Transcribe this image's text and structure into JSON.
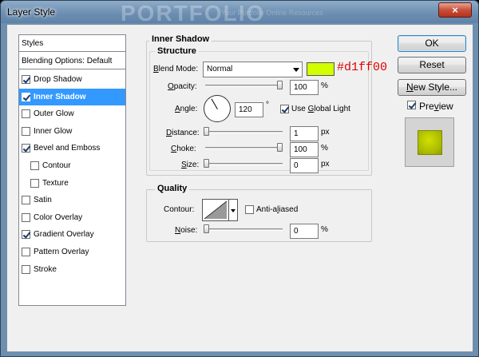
{
  "window": {
    "title": "Layer Style",
    "close_glyph": "×",
    "watermark": "PORTFOLIO",
    "watermark_sub": "Your Portfolio Online Resources"
  },
  "styles_list": {
    "header": "Styles",
    "blending": "Blending Options: Default",
    "items": [
      {
        "label": "Drop Shadow",
        "checked": true,
        "selected": false,
        "indent": false
      },
      {
        "label": "Inner Shadow",
        "checked": true,
        "selected": true,
        "indent": false
      },
      {
        "label": "Outer Glow",
        "checked": false,
        "selected": false,
        "indent": false
      },
      {
        "label": "Inner Glow",
        "checked": false,
        "selected": false,
        "indent": false
      },
      {
        "label": "Bevel and Emboss",
        "checked": true,
        "selected": false,
        "indent": false
      },
      {
        "label": "Contour",
        "checked": false,
        "selected": false,
        "indent": true
      },
      {
        "label": "Texture",
        "checked": false,
        "selected": false,
        "indent": true
      },
      {
        "label": "Satin",
        "checked": false,
        "selected": false,
        "indent": false
      },
      {
        "label": "Color Overlay",
        "checked": false,
        "selected": false,
        "indent": false
      },
      {
        "label": "Gradient Overlay",
        "checked": true,
        "selected": false,
        "indent": false
      },
      {
        "label": "Pattern Overlay",
        "checked": false,
        "selected": false,
        "indent": false
      },
      {
        "label": "Stroke",
        "checked": false,
        "selected": false,
        "indent": false
      }
    ]
  },
  "inner_shadow": {
    "title": "Inner Shadow",
    "structure_title": "Structure",
    "blend_mode_label": "Blend Mode:",
    "blend_mode_value": "Normal",
    "color": "#d1ff00",
    "color_annotation": "#d1ff00",
    "opacity_label": "Opacity:",
    "opacity_value": "100",
    "opacity_fraction": 1.0,
    "angle_label": "Angle:",
    "angle_value": "120",
    "degree_symbol": "°",
    "use_global_light_label": "Use Global Light",
    "use_global_light_checked": true,
    "distance_label": "Distance:",
    "distance_value": "1",
    "distance_fraction": 0.0,
    "choke_label": "Choke:",
    "choke_value": "100",
    "choke_fraction": 1.0,
    "size_label": "Size:",
    "size_value": "0",
    "size_fraction": 0.0,
    "percent_unit": "%",
    "px_unit": "px"
  },
  "quality": {
    "title": "Quality",
    "contour_label": "Contour:",
    "anti_aliased_label": "Anti-aliased",
    "anti_aliased_checked": false,
    "noise_label": "Noise:",
    "noise_value": "0",
    "noise_fraction": 0.0,
    "percent_unit": "%"
  },
  "buttons": {
    "ok": "OK",
    "reset": "Reset",
    "new_style": "New Style...",
    "preview_label": "Preview",
    "preview_checked": true
  }
}
